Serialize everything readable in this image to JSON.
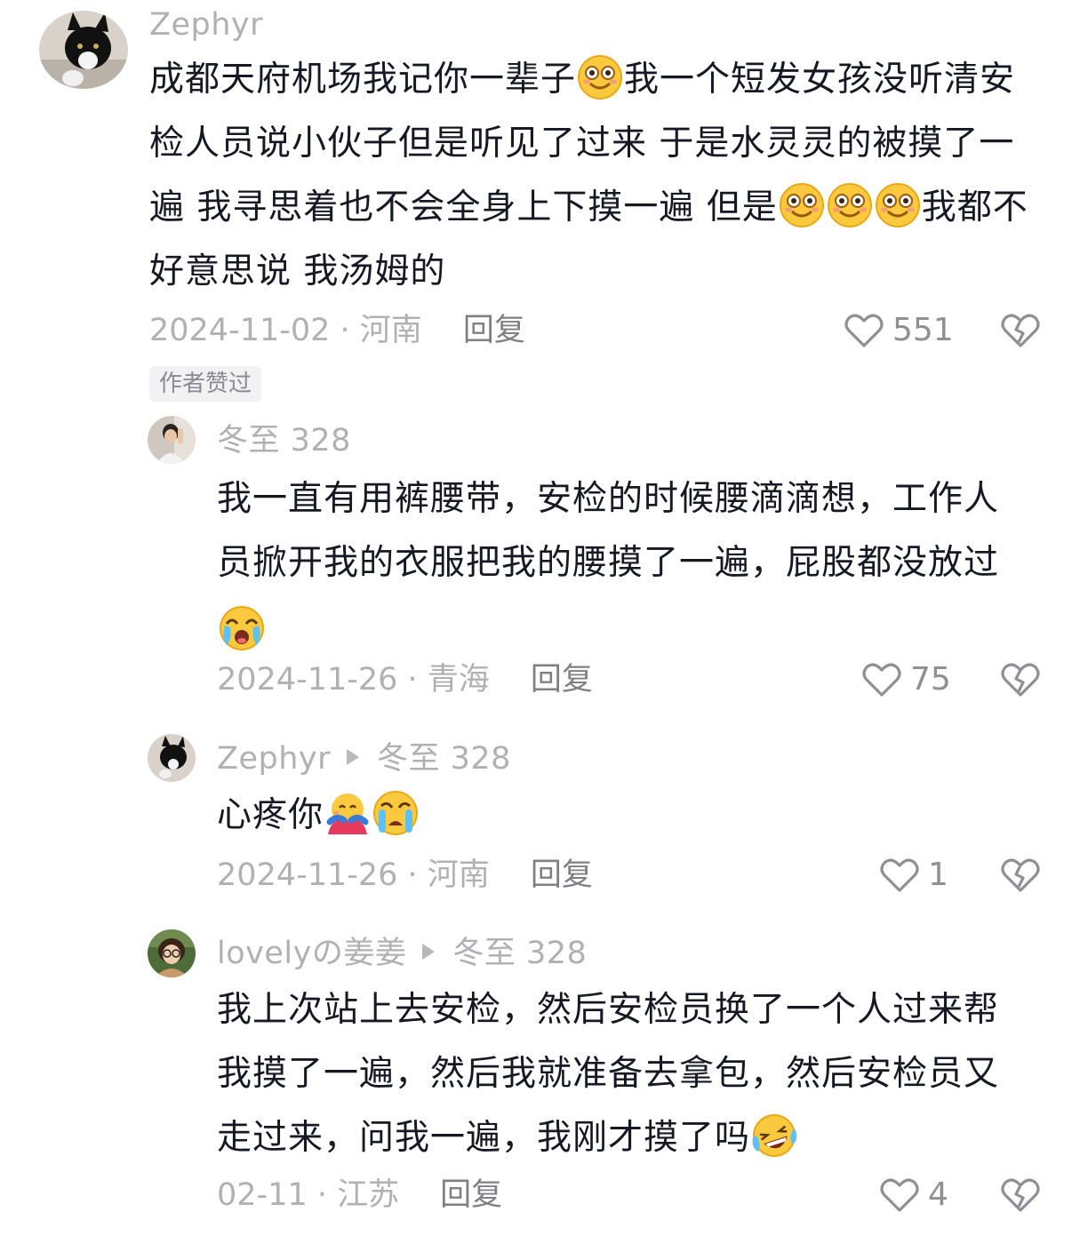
{
  "comments": [
    {
      "user": "Zephyr",
      "text_parts": [
        "成都天府机场我记你一辈子",
        "我一个短发女孩没听清安检人员说小伙子但是听见了过来 于是水灵灵的被摸了一遍 我寻思着也不会全身上下摸一遍 但是",
        "我都不好意思说 我汤姆的"
      ],
      "emojis": [
        "smile-emoji",
        "smile-emoji",
        "smile-emoji",
        "smile-emoji"
      ],
      "date": "2024-11-02",
      "location": "河南",
      "reply_label": "回复",
      "likes": "551",
      "badge": "作者赞过"
    }
  ],
  "replies": [
    {
      "user": "冬至 328",
      "text": "我一直有用裤腰带，安检的时候腰滴滴想，工作人员掀开我的衣服把我的腰摸了一遍，屁股都没放过",
      "emojis": [
        "crying-emoji"
      ],
      "date": "2024-11-26",
      "location": "青海",
      "reply_label": "回复",
      "likes": "75"
    },
    {
      "user": "Zephyr",
      "reply_to": "冬至 328",
      "text": "心疼你",
      "emojis": [
        "hug-emoji",
        "sob-emoji"
      ],
      "date": "2024-11-26",
      "location": "河南",
      "reply_label": "回复",
      "likes": "1"
    },
    {
      "user": "lovelyの姜姜",
      "reply_to": "冬至 328",
      "text": "我上次站上去安检，然后安检员换了一个人过来帮我摸了一遍，然后我就准备去拿包，然后安检员又走过来，问我一遍，我刚才摸了吗",
      "emojis": [
        "laugh-cry-emoji"
      ],
      "date": "02-11",
      "location": "江苏",
      "reply_label": "回复",
      "likes": "4"
    }
  ],
  "separator": " · "
}
